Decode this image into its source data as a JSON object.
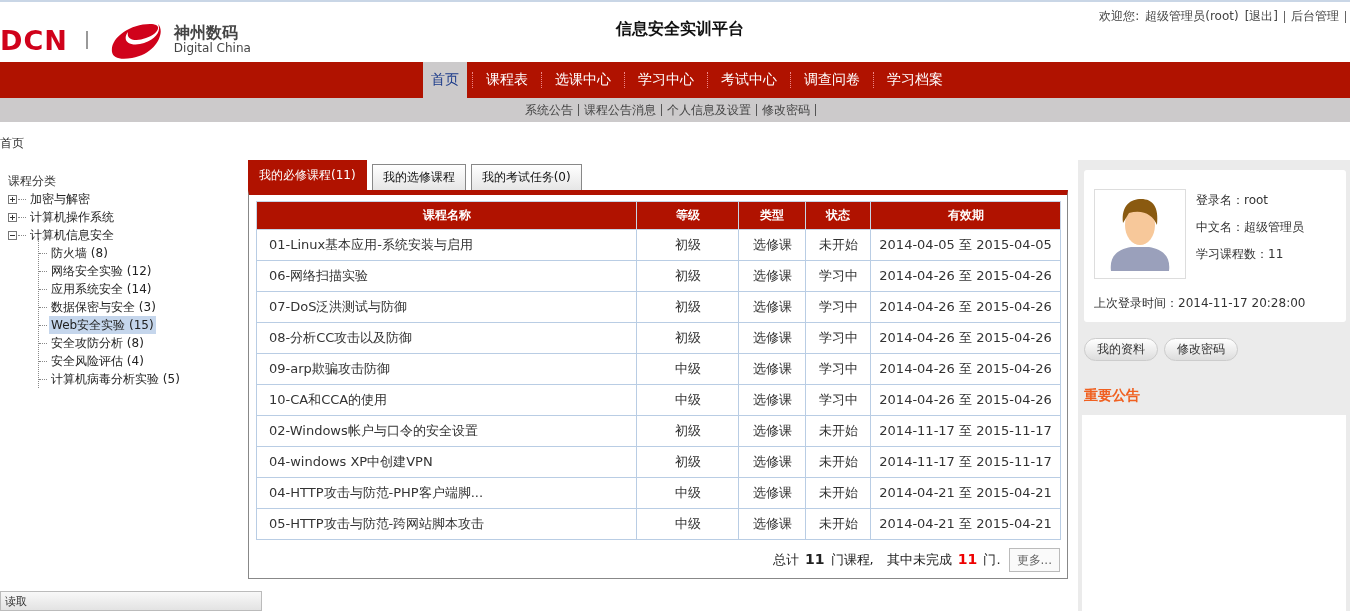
{
  "logo": {
    "brand": "DCN",
    "company_cn": "神州数码",
    "company_en": "Digital China"
  },
  "site_title": "信息安全实训平台",
  "user_bar": {
    "greeting": "欢迎您:",
    "user": "超级管理员(root)",
    "logout": "[退出]",
    "admin": "后台管理"
  },
  "nav": [
    {
      "label": "首页",
      "selected": true
    },
    {
      "label": "课程表",
      "selected": false
    },
    {
      "label": "选课中心",
      "selected": false
    },
    {
      "label": "学习中心",
      "selected": false
    },
    {
      "label": "考试中心",
      "selected": false
    },
    {
      "label": "调查问卷",
      "selected": false
    },
    {
      "label": "学习档案",
      "selected": false
    }
  ],
  "subnav": [
    "系统公告",
    "课程公告消息",
    "个人信息及设置",
    "修改密码"
  ],
  "breadcrumb": "首页",
  "tree": {
    "title": "课程分类",
    "nodes": [
      {
        "label": "加密与解密",
        "expanded": false
      },
      {
        "label": "计算机操作系统",
        "expanded": false
      },
      {
        "label": "计算机信息安全",
        "expanded": true,
        "children": [
          {
            "label": "防火墙 (8)",
            "selected": false
          },
          {
            "label": "网络安全实验 (12)",
            "selected": false
          },
          {
            "label": "应用系统安全 (14)",
            "selected": false
          },
          {
            "label": "数据保密与安全 (3)",
            "selected": false
          },
          {
            "label": "Web安全实验 (15)",
            "selected": true
          },
          {
            "label": "安全攻防分析 (8)",
            "selected": false
          },
          {
            "label": "安全风险评估 (4)",
            "selected": false
          },
          {
            "label": "计算机病毒分析实验 (5)",
            "selected": false
          }
        ]
      }
    ]
  },
  "tabs": [
    {
      "label": "我的必修课程(11)",
      "selected": true
    },
    {
      "label": "我的选修课程",
      "selected": false
    },
    {
      "label": "我的考试任务(0)",
      "selected": false
    }
  ],
  "table": {
    "columns": [
      "课程名称",
      "等级",
      "类型",
      "状态",
      "有效期"
    ],
    "rows": [
      [
        "01-Linux基本应用-系统安装与启用",
        "初级",
        "选修课",
        "未开始",
        "2014-04-05 至 2015-04-05"
      ],
      [
        "06-网络扫描实验",
        "初级",
        "选修课",
        "学习中",
        "2014-04-26 至 2015-04-26"
      ],
      [
        "07-DoS泛洪测试与防御",
        "初级",
        "选修课",
        "学习中",
        "2014-04-26 至 2015-04-26"
      ],
      [
        "08-分析CC攻击以及防御",
        "初级",
        "选修课",
        "学习中",
        "2014-04-26 至 2015-04-26"
      ],
      [
        "09-arp欺骗攻击防御",
        "中级",
        "选修课",
        "学习中",
        "2014-04-26 至 2015-04-26"
      ],
      [
        "10-CA和CCA的使用",
        "中级",
        "选修课",
        "学习中",
        "2014-04-26 至 2015-04-26"
      ],
      [
        "02-Windows帐户与口令的安全设置",
        "初级",
        "选修课",
        "未开始",
        "2014-11-17 至 2015-11-17"
      ],
      [
        "04-windows XP中创建VPN",
        "初级",
        "选修课",
        "未开始",
        "2014-11-17 至 2015-11-17"
      ],
      [
        "04-HTTP攻击与防范-PHP客户端脚...",
        "中级",
        "选修课",
        "未开始",
        "2014-04-21 至 2015-04-21"
      ],
      [
        "05-HTTP攻击与防范-跨网站脚本攻击",
        "中级",
        "选修课",
        "未开始",
        "2014-04-21 至 2015-04-21"
      ]
    ]
  },
  "summary": "总计 **11** 门课程,　其中未完成 **11** 门.",
  "more_button": "更多...",
  "profile": {
    "login_name": "登录名：root",
    "cn_name": "中文名：超级管理员",
    "course_count": "学习课程数：11",
    "last_login": "上次登录时间：2014-11-17 20:28:00"
  },
  "profile_buttons": [
    "我的资料",
    "修改密码"
  ],
  "notice_title": "重要公告",
  "status_bar": "读取"
}
